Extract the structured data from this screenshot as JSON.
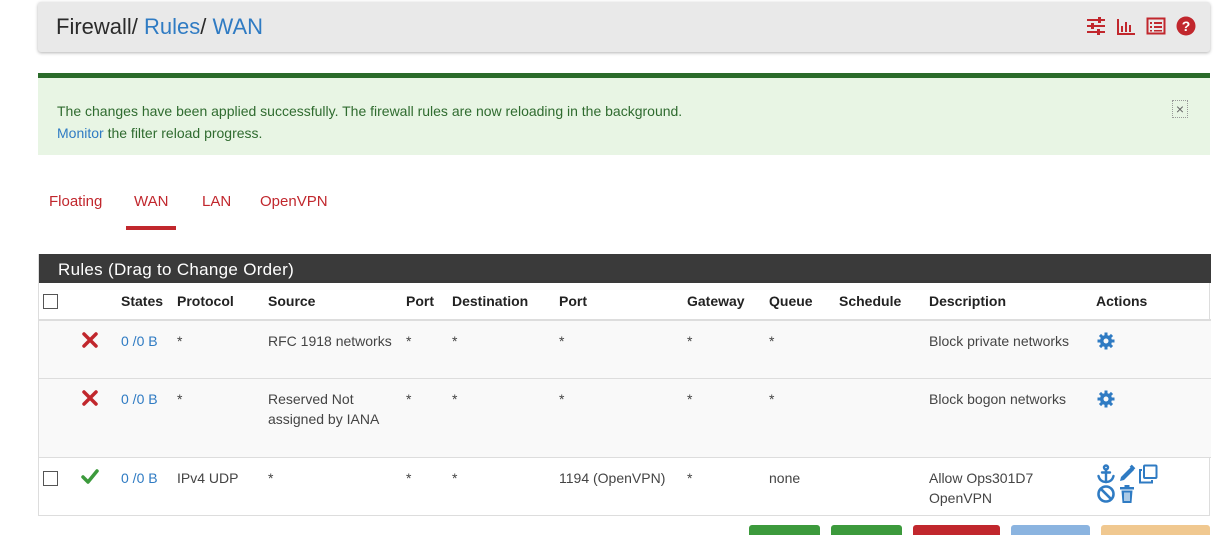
{
  "breadcrumb": {
    "root": "Firewall",
    "sep1": "/",
    "level1": "Rules",
    "sep2": "/",
    "level2": "WAN"
  },
  "header_icons": [
    "sliders-icon",
    "bar-chart-icon",
    "list-icon",
    "help-icon"
  ],
  "alert": {
    "message": "The changes have been applied successfully. The firewall rules are now reloading in the background.",
    "link": "Monitor",
    "link_suffix": " the filter reload progress.",
    "close": "×"
  },
  "tabs": [
    {
      "label": "Floating",
      "active": false
    },
    {
      "label": "WAN",
      "active": true
    },
    {
      "label": "LAN",
      "active": false
    },
    {
      "label": "OpenVPN",
      "active": false
    }
  ],
  "panel": {
    "title": "Rules (Drag to Change Order)"
  },
  "table": {
    "headers": {
      "states": "States",
      "protocol": "Protocol",
      "source": "Source",
      "port": "Port",
      "destination": "Destination",
      "dport": "Port",
      "gateway": "Gateway",
      "queue": "Queue",
      "schedule": "Schedule",
      "description": "Description",
      "actions": "Actions"
    },
    "rows": [
      {
        "status": "block",
        "states": "0 /0 B",
        "protocol": "*",
        "source": "RFC 1918 networks",
        "port": "*",
        "destination": "*",
        "dport": "*",
        "gateway": "*",
        "queue": "*",
        "schedule": "",
        "description": "Block private networks"
      },
      {
        "status": "block",
        "states": "0 /0 B",
        "protocol": "*",
        "source": "Reserved Not assigned by IANA",
        "port": "*",
        "destination": "*",
        "dport": "*",
        "gateway": "*",
        "queue": "*",
        "schedule": "",
        "description": "Block bogon networks"
      },
      {
        "status": "pass",
        "states": "0 /0 B",
        "protocol": "IPv4 UDP",
        "source": "*",
        "port": "*",
        "destination": "*",
        "dport": "1194 (OpenVPN)",
        "gateway": "*",
        "queue": "none",
        "schedule": "",
        "description": "Allow Ops301D7 OpenVPN"
      }
    ]
  },
  "colors": {
    "link": "#2f7bc3",
    "tab": "#c1272d",
    "block": "#c1272d",
    "pass": "#3c9a3c",
    "panel_head": "#3a3a3a",
    "alert_bg": "#e8f5e4",
    "alert_border": "#2a6b2a"
  },
  "bottom_buttons": [
    "green",
    "green",
    "red",
    "blue",
    "orange"
  ]
}
